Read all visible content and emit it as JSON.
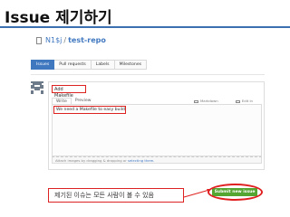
{
  "slide": {
    "title": "Issue 제기하기"
  },
  "repo": {
    "owner": "N1$j",
    "separator": "/",
    "name": "test-repo"
  },
  "tabs": [
    {
      "label": "Issues",
      "active": true
    },
    {
      "label": "Pull requests",
      "active": false
    },
    {
      "label": "Labels",
      "active": false
    },
    {
      "label": "Milestones",
      "active": false
    }
  ],
  "form": {
    "title_value": "Add Makefile",
    "write_tab": "Write",
    "preview_tab": "Preview",
    "markdown_note": "Markdown supported",
    "fullscreen_note": "Edit in fullscreen",
    "body_value": "We need a Makefile to easy build",
    "attach_text": "Attach images by dragging & dropping or ",
    "attach_link": "selecting them."
  },
  "submit": {
    "label": "Submit new issue"
  },
  "callout": {
    "text": "제기된 이슈는 모든 사람이 볼 수 있음"
  },
  "colors": {
    "accent": "#4078c0",
    "submit": "#55a532",
    "highlight": "#e02020"
  }
}
